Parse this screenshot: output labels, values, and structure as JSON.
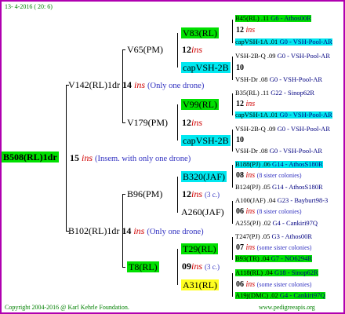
{
  "header": "13- 4-2016 ( 20: 6)",
  "footer_left": "Copyright 2004-2016 @ Karl Kehrle Foundation.",
  "footer_right": "www.pedigreeapis.org",
  "root": {
    "id": "B508(RL)1dr",
    "num": "15",
    "ins": "ins",
    "note": "(Insem. with only one drone)"
  },
  "g1a": {
    "id": "V142(RL)1dr",
    "num": "14",
    "ins": "ins",
    "note": "(Only one drone)"
  },
  "g1b": {
    "id": "B102(RL)1dr",
    "num": "14",
    "ins": "ins",
    "note": "(Only one drone)"
  },
  "g2a": {
    "id": "V65(PM)",
    "num": "12",
    "ins": "ins"
  },
  "g2b": {
    "id": "V179(PM)",
    "num": "12",
    "ins": "ins"
  },
  "g2c": {
    "id": "B96(PM)",
    "num": "12",
    "ins": "ins",
    "note": "(3 c.)"
  },
  "g2d": {
    "id": "T8(RL)",
    "num": "09",
    "ins": "ins",
    "note": "(3 c.)"
  },
  "g3": [
    {
      "id": "V83(RL)"
    },
    {
      "id": "capVSH-2B"
    },
    {
      "id": "V99(RL)"
    },
    {
      "id": "capVSH-2B"
    },
    {
      "id": "B320(JAF)"
    },
    {
      "id": "A260(JAF)"
    },
    {
      "id": "T29(RL)"
    },
    {
      "id": "A31(RL)"
    }
  ],
  "g4": [
    {
      "a": "B45(RL) .11",
      "a2": "G6 - Athos00R",
      "num": "12",
      "ins": "ins",
      "note": "",
      "b": "capVSH-1A .01",
      "b2": "G0 - VSH-Pool-AR"
    },
    {
      "a": "VSH-2B-Q .09",
      "a2": "G0 - VSH-Pool-AR",
      "num": "10",
      "ins": "",
      "note": "",
      "b": "VSH-Dr .08",
      "b2": "G0 - VSH-Pool-AR"
    },
    {
      "a": "B35(RL) .11",
      "a2": "G22 - Sinop62R",
      "num": "12",
      "ins": "ins",
      "note": "",
      "b": "capVSH-1A .01",
      "b2": "G0 - VSH-Pool-AR"
    },
    {
      "a": "VSH-2B-Q .09",
      "a2": "G0 - VSH-Pool-AR",
      "num": "10",
      "ins": "",
      "note": "",
      "b": "VSH-Dr .08",
      "b2": "G0 - VSH-Pool-AR"
    },
    {
      "a": "B188(PJ) .06",
      "a2": "G14 - AthosS180R",
      "num": "08",
      "ins": "ins",
      "note": "(8 sister colonies)",
      "b": "B124(PJ) .05",
      "b2": "G14 - AthosS180R"
    },
    {
      "a": "A100(JAF) .04",
      "a2": "G23 - Bayburt98-3",
      "num": "06",
      "ins": "ins",
      "note": "(8 sister colonies)",
      "b": "A255(PJ) .02",
      "b2": "G4 - Cankiri97Q"
    },
    {
      "a": "T247(PJ) .05",
      "a2": "G3 - Athos00R",
      "num": "07",
      "ins": "ins",
      "note": "(some sister colonies)",
      "b": "B93(TR) .04",
      "b2": "G7 - NO6294R"
    },
    {
      "a": "A118(RL) .04",
      "a2": "G18 - Sinop62R",
      "num": "06",
      "ins": "ins",
      "note": "(some sister colonies)",
      "b": "A19j(DMC) .02",
      "b2": "G4 - Cankiri97Q"
    }
  ]
}
